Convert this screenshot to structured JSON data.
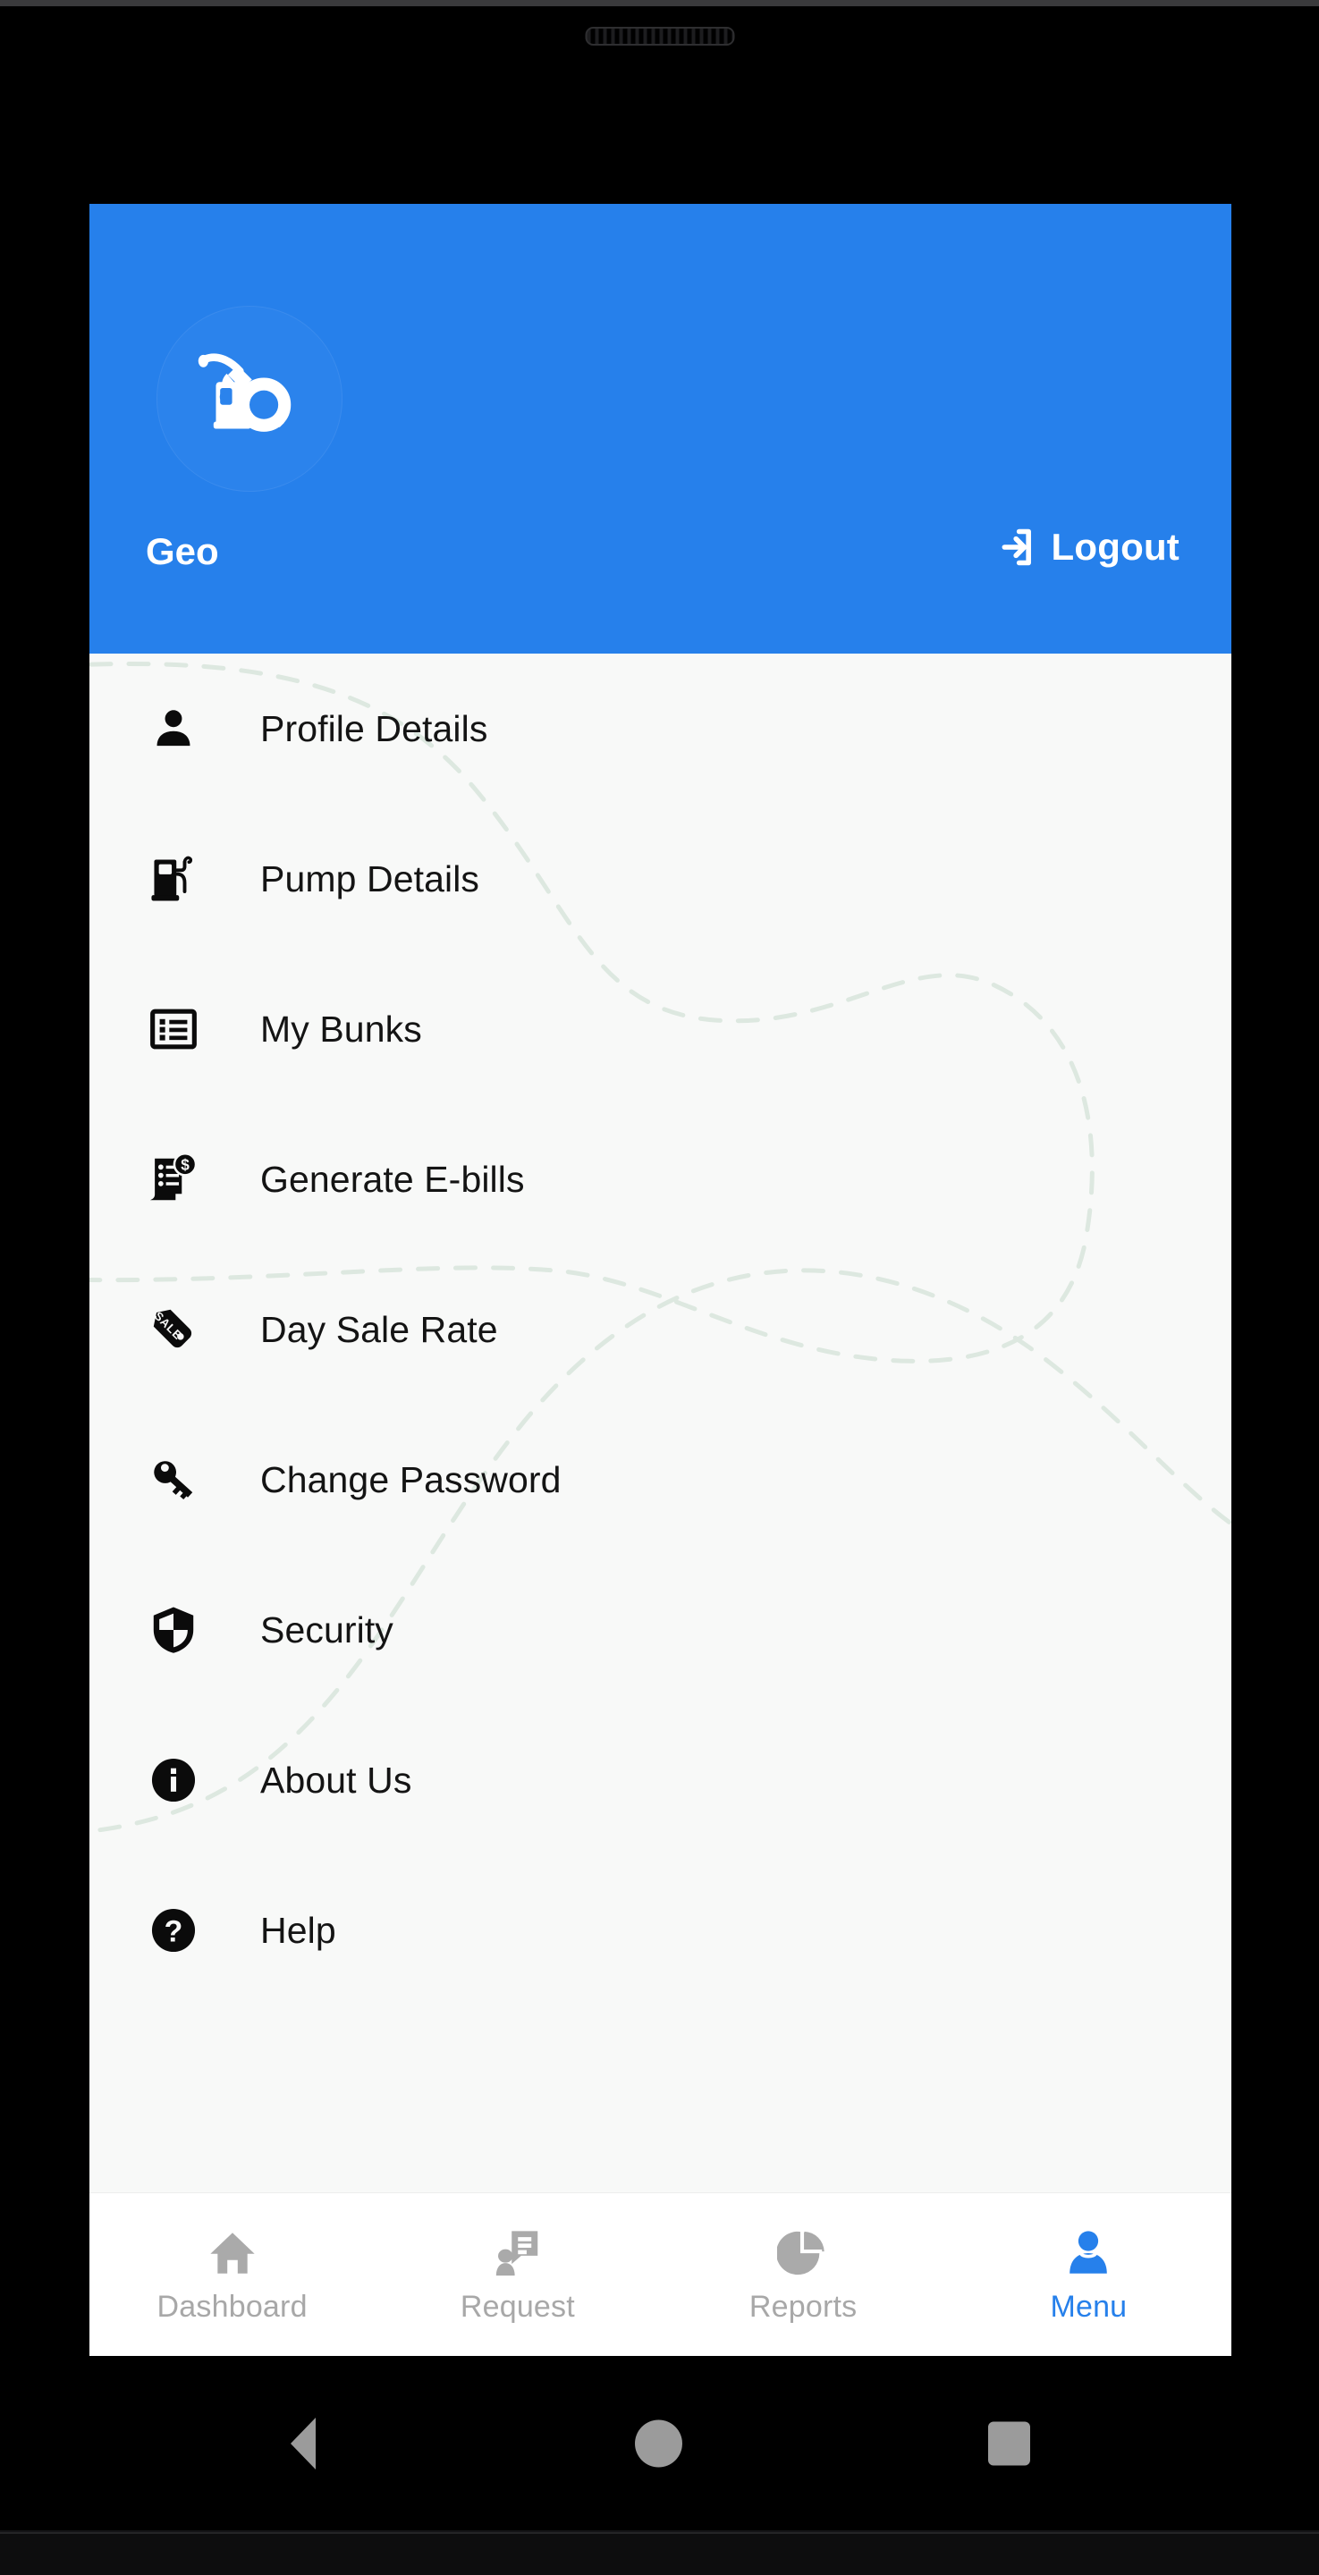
{
  "app": {
    "brand_color": "#2680eb",
    "screen_background": "#f8f9f8",
    "decor_dash_color": "#dde8e0"
  },
  "header": {
    "avatar_icon": "fuel-pump-gauge-logo",
    "username": "Geo",
    "logout": {
      "icon": "logout-arrow-icon",
      "label": "Logout"
    }
  },
  "menu": {
    "items": [
      {
        "icon": "person-icon",
        "label": "Profile Details"
      },
      {
        "icon": "fuel-pump-icon",
        "label": "Pump Details"
      },
      {
        "icon": "list-card-icon",
        "label": "My Bunks"
      },
      {
        "icon": "invoice-dollar-icon",
        "label": "Generate E-bills"
      },
      {
        "icon": "sale-tag-icon",
        "label": "Day Sale Rate"
      },
      {
        "icon": "key-icon",
        "label": "Change Password"
      },
      {
        "icon": "shield-icon",
        "label": "Security"
      },
      {
        "icon": "info-circle-icon",
        "label": "About Us"
      },
      {
        "icon": "question-circle-icon",
        "label": "Help"
      }
    ]
  },
  "bottom_nav": {
    "active_index": 3,
    "active_color": "#2680eb",
    "inactive_color": "#a8a8a8",
    "items": [
      {
        "icon": "home-icon",
        "label": "Dashboard"
      },
      {
        "icon": "request-message-icon",
        "label": "Request"
      },
      {
        "icon": "pie-chart-icon",
        "label": "Reports"
      },
      {
        "icon": "person-filled-icon",
        "label": "Menu"
      }
    ]
  },
  "system_nav": {
    "back": "back-triangle-icon",
    "home": "home-circle-icon",
    "recents": "recents-square-icon"
  }
}
